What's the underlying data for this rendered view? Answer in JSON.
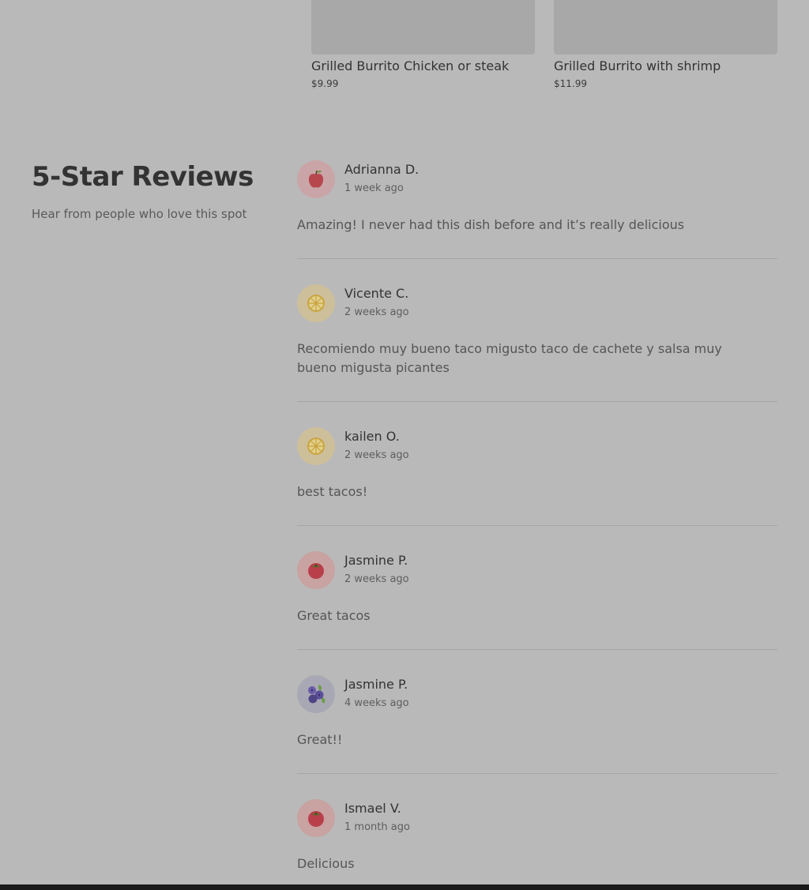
{
  "menu_items": [
    {
      "name": "Grilled Burrito Chicken or steak",
      "price": "$9.99"
    },
    {
      "name": "Grilled Burrito with shrimp",
      "price": "$11.99"
    }
  ],
  "reviews_section": {
    "title": "5-Star Reviews",
    "subtitle": "Hear from people who love this spot"
  },
  "reviews": [
    {
      "name": "Adrianna D.",
      "time": "1 week ago",
      "text": "Amazing! I never had this dish before and it’s really delicious",
      "avatar_icon": "apple-icon"
    },
    {
      "name": "Vicente C.",
      "time": "2 weeks ago",
      "text": "Recomiendo muy bueno taco migusto taco de cachete y salsa muy bueno migusta picantes",
      "avatar_icon": "lemon-slice-icon"
    },
    {
      "name": "kailen O.",
      "time": "2 weeks ago",
      "text": "best tacos!",
      "avatar_icon": "lemon-slice-icon"
    },
    {
      "name": "Jasmine P.",
      "time": "2 weeks ago",
      "text": "Great tacos",
      "avatar_icon": "tomato-icon"
    },
    {
      "name": "Jasmine P.",
      "time": "4 weeks ago",
      "text": "Great!!",
      "avatar_icon": "blueberries-icon"
    },
    {
      "name": "Ismael V.",
      "time": "1 month ago",
      "text": "Delicious",
      "avatar_icon": "tomato-icon"
    }
  ],
  "colors": {
    "overlay_background": "#b9b9b9",
    "apple_avatar_bg": "#caa5a7",
    "lemon_avatar_bg": "#cdbf9a",
    "tomato_avatar_bg": "#c9a2a2",
    "blueberry_avatar_bg": "#a8a8b4"
  }
}
